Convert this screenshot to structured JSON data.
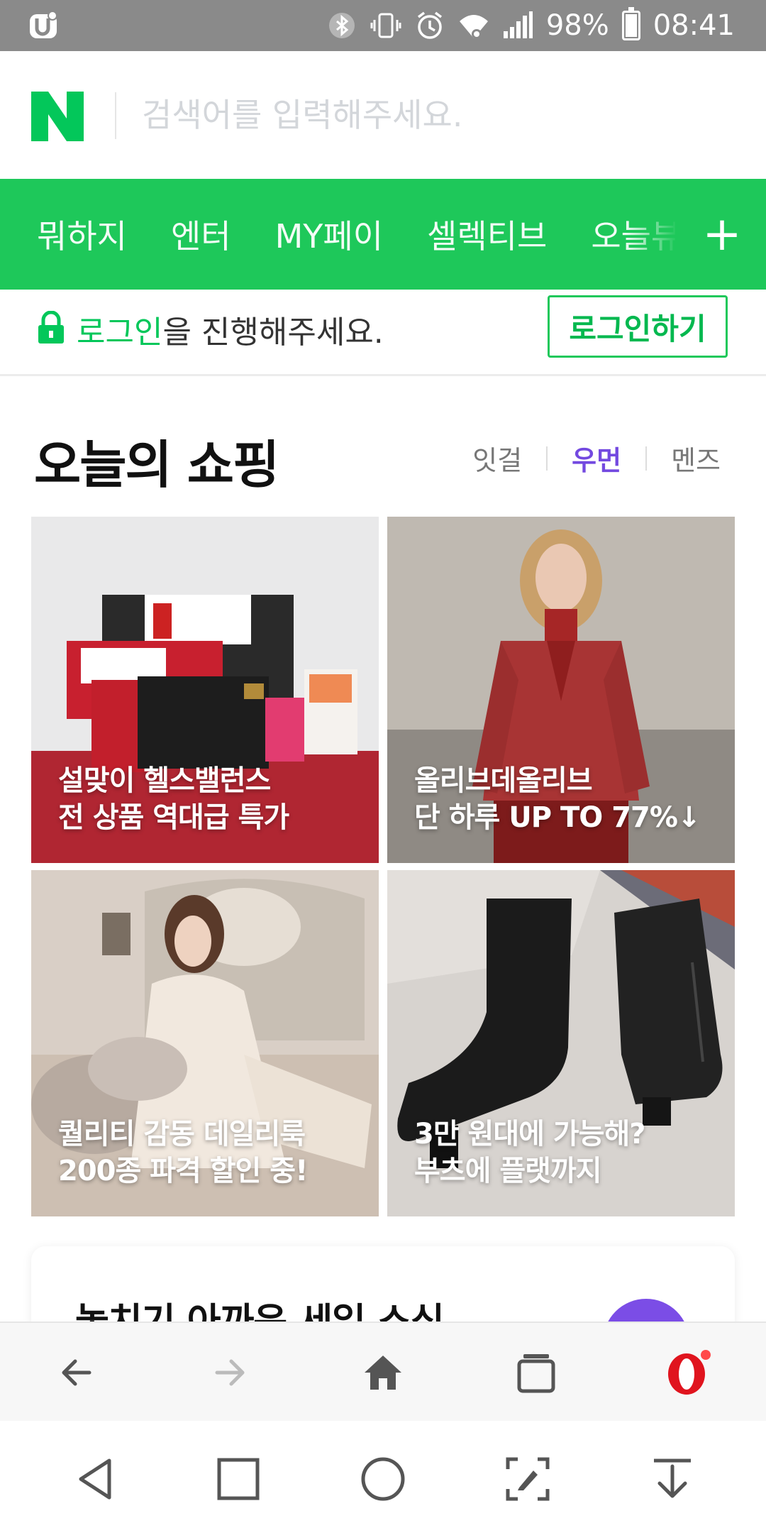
{
  "status_bar": {
    "battery": "98%",
    "time": "08:41",
    "battery_level": 0.98,
    "icons": [
      "app-icon",
      "bluetooth-icon",
      "vibrate-icon",
      "alarm-icon",
      "wifi-icon",
      "signal-icon",
      "battery-icon"
    ]
  },
  "search": {
    "logo": "N",
    "placeholder": "검색어를 입력해주세요."
  },
  "nav": {
    "items": [
      "뭐하지",
      "엔터",
      "MY페이",
      "셀렉티브",
      "오늘뷰티"
    ],
    "plus": "+"
  },
  "login": {
    "message_highlight": "로그인",
    "message_rest": "을 진행해주세요.",
    "button": "로그인하기"
  },
  "shopping": {
    "title": "오늘의 쇼핑",
    "tabs": [
      "잇걸",
      "우먼",
      "멘즈"
    ],
    "active_tab": "우먼",
    "tiles": [
      {
        "line1": "설맞이 헬스밸런스",
        "line2": "전 상품 역대급 특가"
      },
      {
        "line1": "올리브데올리브",
        "line2": "단 하루 UP TO 77%↓"
      },
      {
        "line1": "퀄리티 감동 데일리룩",
        "line2": "200종 파격 할인 중!"
      },
      {
        "line1": "3만 원대에 가능해?",
        "line2": "부츠에 플랫까지"
      }
    ]
  },
  "sale_card": {
    "title": "놓치기 아까운 세일 소식"
  },
  "colors": {
    "naver_green": "#1ec85a",
    "accent_purple": "#7349e0",
    "opera_red": "#e0141e"
  },
  "browser_bar": {
    "icons": [
      "back-arrow-icon",
      "forward-arrow-icon",
      "home-icon",
      "tabs-icon",
      "opera-icon"
    ]
  },
  "android_bar": {
    "icons": [
      "back-triangle-icon",
      "recents-square-icon",
      "home-circle-icon",
      "screenshot-edit-icon",
      "notification-pull-icon"
    ]
  }
}
